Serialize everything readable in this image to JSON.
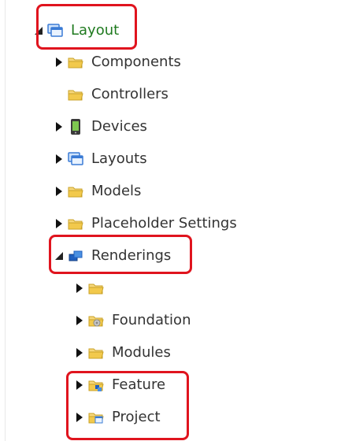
{
  "tree": {
    "root": {
      "label": "Layout",
      "expanded": true,
      "icon": "layout-window-icon"
    },
    "items": [
      {
        "label": "Components",
        "icon": "folder-icon"
      },
      {
        "label": "Controllers",
        "icon": "folder-icon"
      },
      {
        "label": "Devices",
        "icon": "device-icon"
      },
      {
        "label": "Layouts",
        "icon": "layout-window-icon"
      },
      {
        "label": "Models",
        "icon": "folder-icon"
      },
      {
        "label": "Placeholder Settings",
        "icon": "folder-icon"
      },
      {
        "label": "Renderings",
        "expanded": true,
        "icon": "renderings-icon"
      }
    ],
    "renderings_children": [
      {
        "label": "",
        "icon": "folder-icon"
      },
      {
        "label": "Foundation",
        "icon": "folder-gear-icon"
      },
      {
        "label": "Modules",
        "icon": "folder-icon"
      },
      {
        "label": "Feature",
        "icon": "folder-feature-icon"
      },
      {
        "label": "Project",
        "icon": "folder-window-icon"
      }
    ]
  },
  "colors": {
    "highlight_border": "#e0141e",
    "selected_text": "#1f7a1f",
    "folder_yellow": "#f2c94c",
    "layout_blue": "#3a7bd5"
  }
}
